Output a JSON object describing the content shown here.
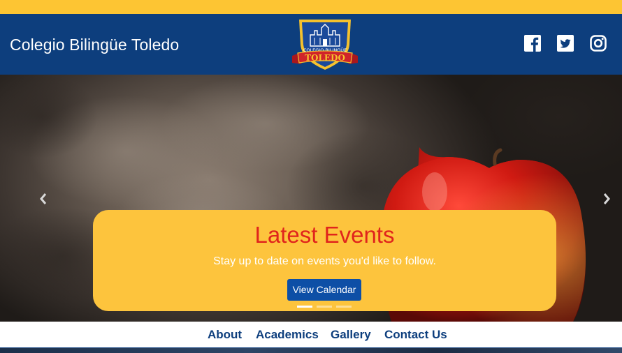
{
  "header": {
    "site_title": "Colegio Bilingüe Toledo",
    "logo": {
      "top_text": "COLEGIO BILINGÜE",
      "banner_text": "TOLEDO",
      "colors": {
        "shield": "#1b4a9a",
        "border": "#f5c12e",
        "banner": "#d0232a"
      }
    },
    "social": [
      {
        "name": "facebook",
        "icon": "facebook-icon"
      },
      {
        "name": "twitter",
        "icon": "twitter-icon"
      },
      {
        "name": "instagram",
        "icon": "instagram-icon"
      }
    ]
  },
  "hero": {
    "caption": {
      "title": "Latest Events",
      "text": "Stay up to date on events you'd like to follow.",
      "button_label": "View Calendar"
    },
    "slides": {
      "count": 3,
      "active_index": 0
    },
    "arrows": {
      "prev_icon": "chevron-left-icon",
      "next_icon": "chevron-right-icon"
    }
  },
  "nav": {
    "items": [
      {
        "label": "About"
      },
      {
        "label": "Academics"
      },
      {
        "label": "Gallery"
      },
      {
        "label": "Contact Us"
      }
    ]
  },
  "colors": {
    "top_bar": "#fdc533",
    "header_bg": "#0d3e7d",
    "caption_bg": "#fdc43d",
    "caption_title": "#e0241c",
    "button_bg": "#0d4fa6",
    "nav_text": "#0d3e7d"
  }
}
